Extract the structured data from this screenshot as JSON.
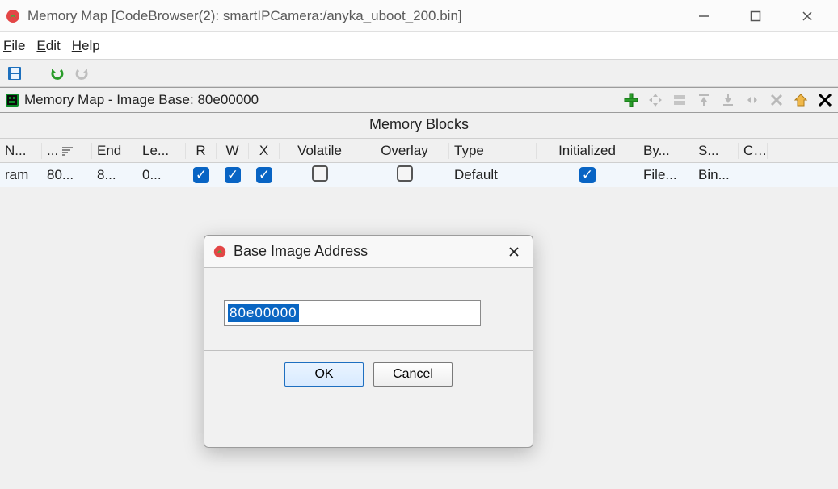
{
  "window": {
    "title": "Memory Map [CodeBrowser(2): smartIPCamera:/anyka_uboot_200.bin]"
  },
  "menu": {
    "file": "File",
    "edit": "Edit",
    "help": "Help"
  },
  "panel": {
    "title": "Memory Map - Image Base: 80e00000",
    "section": "Memory Blocks"
  },
  "columns": {
    "name": "N...",
    "start": "...",
    "end": "End",
    "length": "Le...",
    "r": "R",
    "w": "W",
    "x": "X",
    "volatile": "Volatile",
    "overlay": "Overlay",
    "type": "Type",
    "initialized": "Initialized",
    "byte": "By...",
    "source": "S...",
    "comment": "C..."
  },
  "rows": [
    {
      "name": "ram",
      "start": "80...",
      "end": "8...",
      "length": "0...",
      "r": true,
      "w": true,
      "x": true,
      "volatile": false,
      "overlay": false,
      "type": "Default",
      "initialized": true,
      "byte": "File...",
      "source": "Bin...",
      "comment": ""
    }
  ],
  "dialog": {
    "title": "Base Image Address",
    "value": "80e00000",
    "ok": "OK",
    "cancel": "Cancel"
  }
}
